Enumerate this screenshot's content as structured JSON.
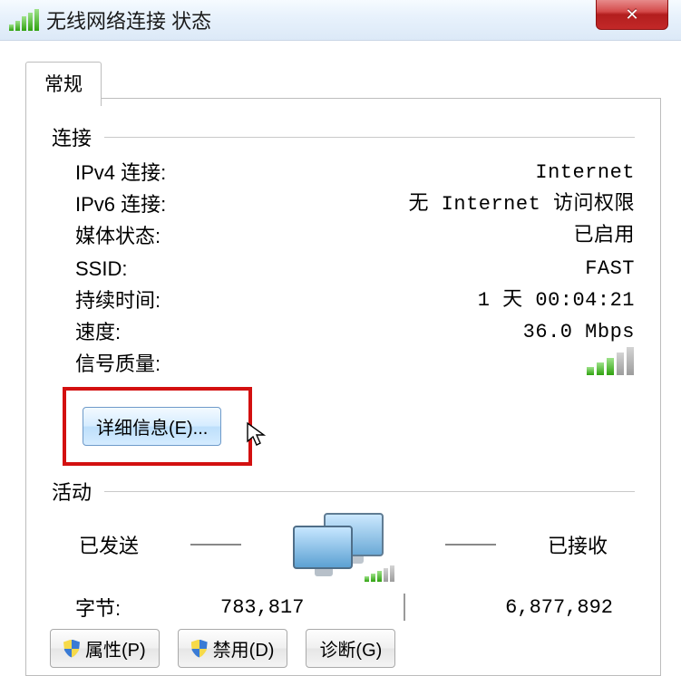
{
  "window": {
    "title": "无线网络连接 状态",
    "close_label": "✕"
  },
  "tab": {
    "general": "常规"
  },
  "sections": {
    "connection": "连接",
    "activity": "活动"
  },
  "conn": {
    "ipv4_label": "IPv4 连接:",
    "ipv4_value": "Internet",
    "ipv6_label": "IPv6 连接:",
    "ipv6_value": "无 Internet 访问权限",
    "media_label": "媒体状态:",
    "media_value": "已启用",
    "ssid_label": "SSID:",
    "ssid_value": "FAST",
    "duration_label": "持续时间:",
    "duration_value": "1 天 00:04:21",
    "speed_label": "速度:",
    "speed_value": "36.0 Mbps",
    "signal_label": "信号质量:"
  },
  "details_btn": "详细信息(E)...",
  "activity": {
    "sent_label": "已发送",
    "received_label": "已接收",
    "bytes_label": "字节:",
    "sent_value": "783,817",
    "received_value": "6,877,892"
  },
  "buttons": {
    "properties": "属性(P)",
    "disable": "禁用(D)",
    "diagnose": "诊断(G)"
  }
}
